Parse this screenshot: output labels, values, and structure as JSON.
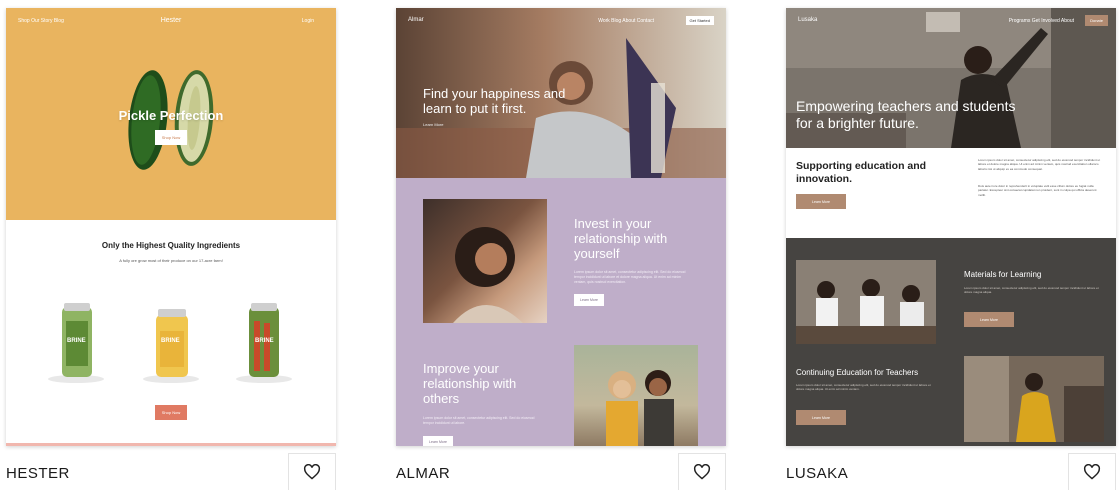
{
  "cards": [
    {
      "name": "HESTER",
      "preview": {
        "nav_left": "Shop   Our Story   Blog",
        "brand": "Hester",
        "nav_right": "Login",
        "hero_title": "Pickle Perfection",
        "hero_button": "Shop Now",
        "section_title": "Only the Highest Quality Ingredients",
        "section_sub": "A fully ore grow most of their produce on our 17-acre farm!",
        "jar_label": "BRINE",
        "shop_button": "Shop Now"
      }
    },
    {
      "name": "ALMAR",
      "preview": {
        "brand": "Almar",
        "nav_links": "Work   Blog   About   Contact",
        "nav_button": "Get Started",
        "hero_title": "Find your happiness and learn to put it first.",
        "hero_link": "Learn More",
        "block1_title": "Invest in your relationship with yourself",
        "block1_text": "Lorem ipsum dolor sit amet, consectetur adipiscing elit. Sed do eiusmod tempor incididunt ut labore et dolore magna aliqua. Ut enim ad minim veniam, quis nostrud exercitation.",
        "block1_button": "Learn More",
        "block2_title": "Improve your relationship with others",
        "block2_text": "Lorem ipsum dolor sit amet, consectetur adipiscing elit. Sed do eiusmod tempor incididunt ut labore.",
        "block2_button": "Learn More"
      }
    },
    {
      "name": "LUSAKA",
      "preview": {
        "brand": "Lusaka",
        "nav_links": "Programs   Get Involved   About",
        "nav_button": "Donate",
        "hero_title": "Empowering teachers and students for a brighter future.",
        "support_title": "Supporting education and innovation.",
        "support_text_1": "Lorem ipsum dolor sit amet, consectetur adipiscing elit, sed do eiusmod tempor incididunt ut labore et dolore magna aliqua. Ut enim ad minim veniam, quis nostrud exercitation ullamco laboris nisi ut aliquip ex ea commodo consequat.",
        "support_text_2": "Duis aute irure dolor in reprehenderit in voluptate velit esse cillum dolore eu fugiat nulla pariatur. Excepteur sint occaecat cupidatat non proident, sunt in culpa qui officia deserunt mollit.",
        "support_button": "Learn More",
        "block1_title": "Materials for Learning",
        "block1_text": "Lorem ipsum dolor sit amet, consectetur adipiscing elit, sed do eiusmod tempor incididunt ut labore et dolore magna aliqua.",
        "block1_button": "Learn More",
        "block2_title": "Continuing Education for Teachers",
        "block2_text": "Lorem ipsum dolor sit amet, consectetur adipiscing elit, sed do eiusmod tempor incididunt ut labore et dolore magna aliqua. Ut enim ad minim veniam.",
        "block2_button": "Learn More"
      }
    }
  ],
  "icons": {
    "favorite": "heart-outline-icon"
  },
  "colors": {
    "hester_hero": "#e9b45f",
    "hester_button": "#e07a63",
    "almar_lavender": "#bfaec9",
    "lusaka_accent": "#b08a71",
    "lusaka_dark": "#464441"
  }
}
